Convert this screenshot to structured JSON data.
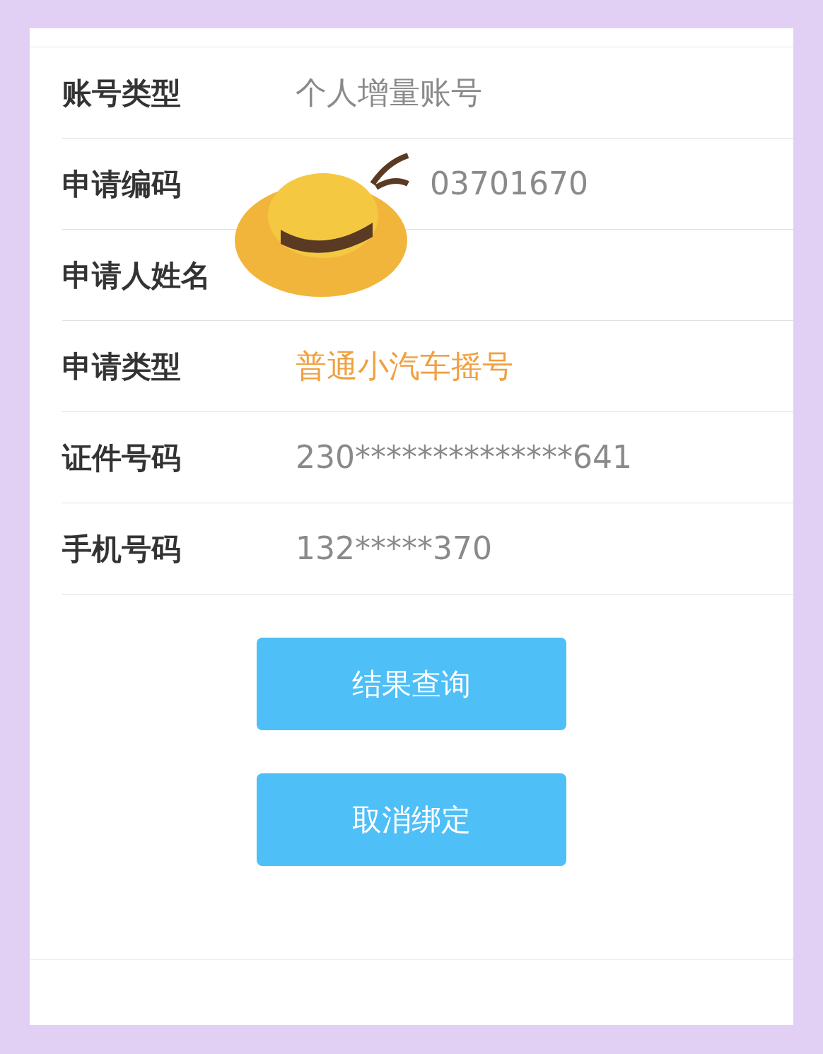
{
  "rows": [
    {
      "label": "账号类型",
      "value": "个人增量账号",
      "kind": "normal"
    },
    {
      "label": "申请编码",
      "value": "03701670",
      "kind": "normal"
    },
    {
      "label": "申请人姓名"
    },
    {
      "label": "申请类型",
      "value": "普通小汽车摇号",
      "kind": "highlight"
    },
    {
      "label": "证件号码",
      "value": "230**************641",
      "kind": "normal"
    },
    {
      "label": "手机号码",
      "value": "132*****370",
      "kind": "normal"
    }
  ],
  "buttons": [
    "结果查询",
    "取消绑定"
  ]
}
